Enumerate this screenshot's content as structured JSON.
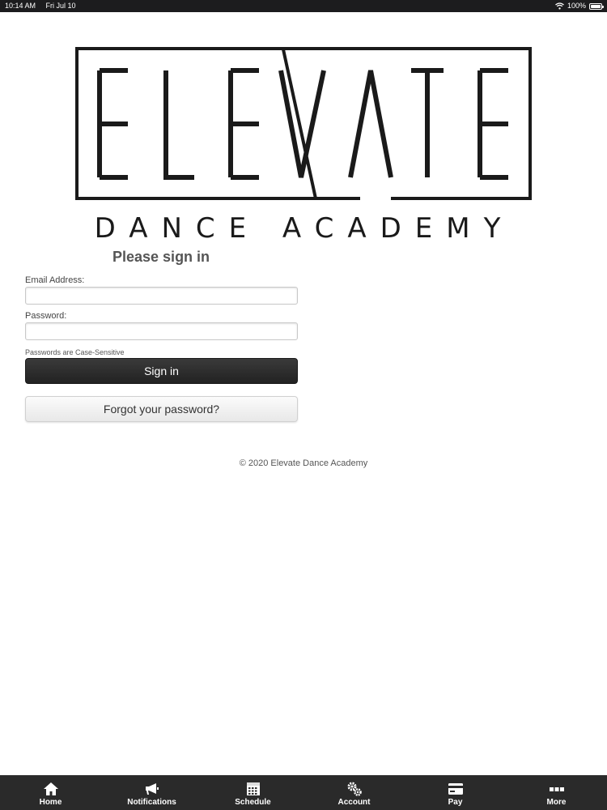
{
  "status_bar": {
    "time": "10:14 AM",
    "date": "Fri Jul 10",
    "battery": "100%",
    "battery_level": 1.0,
    "icons": [
      "wifi-icon",
      "battery-icon"
    ]
  },
  "logo": {
    "wordmark": "ELEVATE",
    "tagline": "DANCE ACADEMY"
  },
  "form": {
    "title": "Please sign in",
    "email_label": "Email Address:",
    "email_value": "",
    "password_label": "Password:",
    "password_value": "",
    "hint": "Passwords are Case-Sensitive",
    "sign_in_label": "Sign in",
    "forgot_label": "Forgot your password?"
  },
  "footer": {
    "copyright": "© 2020 Elevate Dance Academy"
  },
  "tab_bar": {
    "items": [
      {
        "label": "Home",
        "icon": "home-icon"
      },
      {
        "label": "Notifications",
        "icon": "megaphone-icon"
      },
      {
        "label": "Schedule",
        "icon": "calendar-icon"
      },
      {
        "label": "Account",
        "icon": "gears-icon"
      },
      {
        "label": "Pay",
        "icon": "credit-card-icon"
      },
      {
        "label": "More",
        "icon": "more-icon"
      }
    ]
  },
  "colors": {
    "status_bar_bg": "#1c1c1e",
    "tab_bar_bg": "#2a2a2a",
    "primary_button": "#2c2c2c"
  }
}
